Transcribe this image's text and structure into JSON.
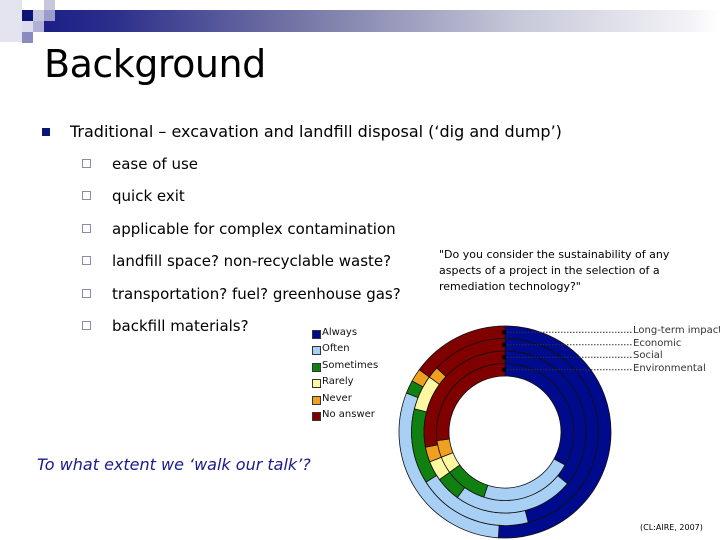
{
  "slide": {
    "title": "Background",
    "bullet": "Traditional – excavation and landfill disposal (‘dig and dump’)",
    "sub_bullets": [
      "ease of use",
      "quick exit",
      "applicable for complex contamination",
      "landfill space? non-recyclable waste?",
      "transportation? fuel? greenhouse gas?",
      "backfill materials?"
    ],
    "question_caption": "\"Do you consider the sustainability of any aspects of a project in the selection of a remediation technology?\"",
    "walk_talk": "To what extent we ‘walk our talk’?",
    "citation": "(CL:AIRE, 2007)",
    "colors": {
      "accent": "#0c1478",
      "header_gradient_start": "#1b1f86",
      "sub_bullet_box": "#8b8aa8",
      "italic_text": "#1a1a8c"
    }
  },
  "chart_data": {
    "type": "pie",
    "subtype": "multi-ring donut",
    "title": "\"Do you consider the sustainability of any aspects of a project in the selection of a remediation technology?\"",
    "legend_placement": "left",
    "legend": [
      {
        "name": "Always",
        "color": "#000a8c"
      },
      {
        "name": "Often",
        "color": "#a8d0f5"
      },
      {
        "name": "Sometimes",
        "color": "#108010"
      },
      {
        "name": "Rarely",
        "color": "#fff8a0"
      },
      {
        "name": "Never",
        "color": "#f0a020"
      },
      {
        "name": "No answer",
        "color": "#800000"
      }
    ],
    "categories": [
      "Always",
      "Often",
      "Sometimes",
      "Rarely",
      "Never",
      "No answer"
    ],
    "series": [
      {
        "name": "Long-term impact",
        "ring": "outer",
        "values": [
          51,
          30,
          2,
          0,
          2,
          15
        ]
      },
      {
        "name": "Economic",
        "ring": "second",
        "values": [
          46,
          20,
          13,
          6,
          2,
          13
        ]
      },
      {
        "name": "Social",
        "ring": "third",
        "values": [
          36,
          24,
          5,
          4,
          3,
          28
        ]
      },
      {
        "name": "Environmental",
        "ring": "inner",
        "values": [
          33,
          22,
          10,
          4,
          4,
          27
        ]
      }
    ]
  }
}
